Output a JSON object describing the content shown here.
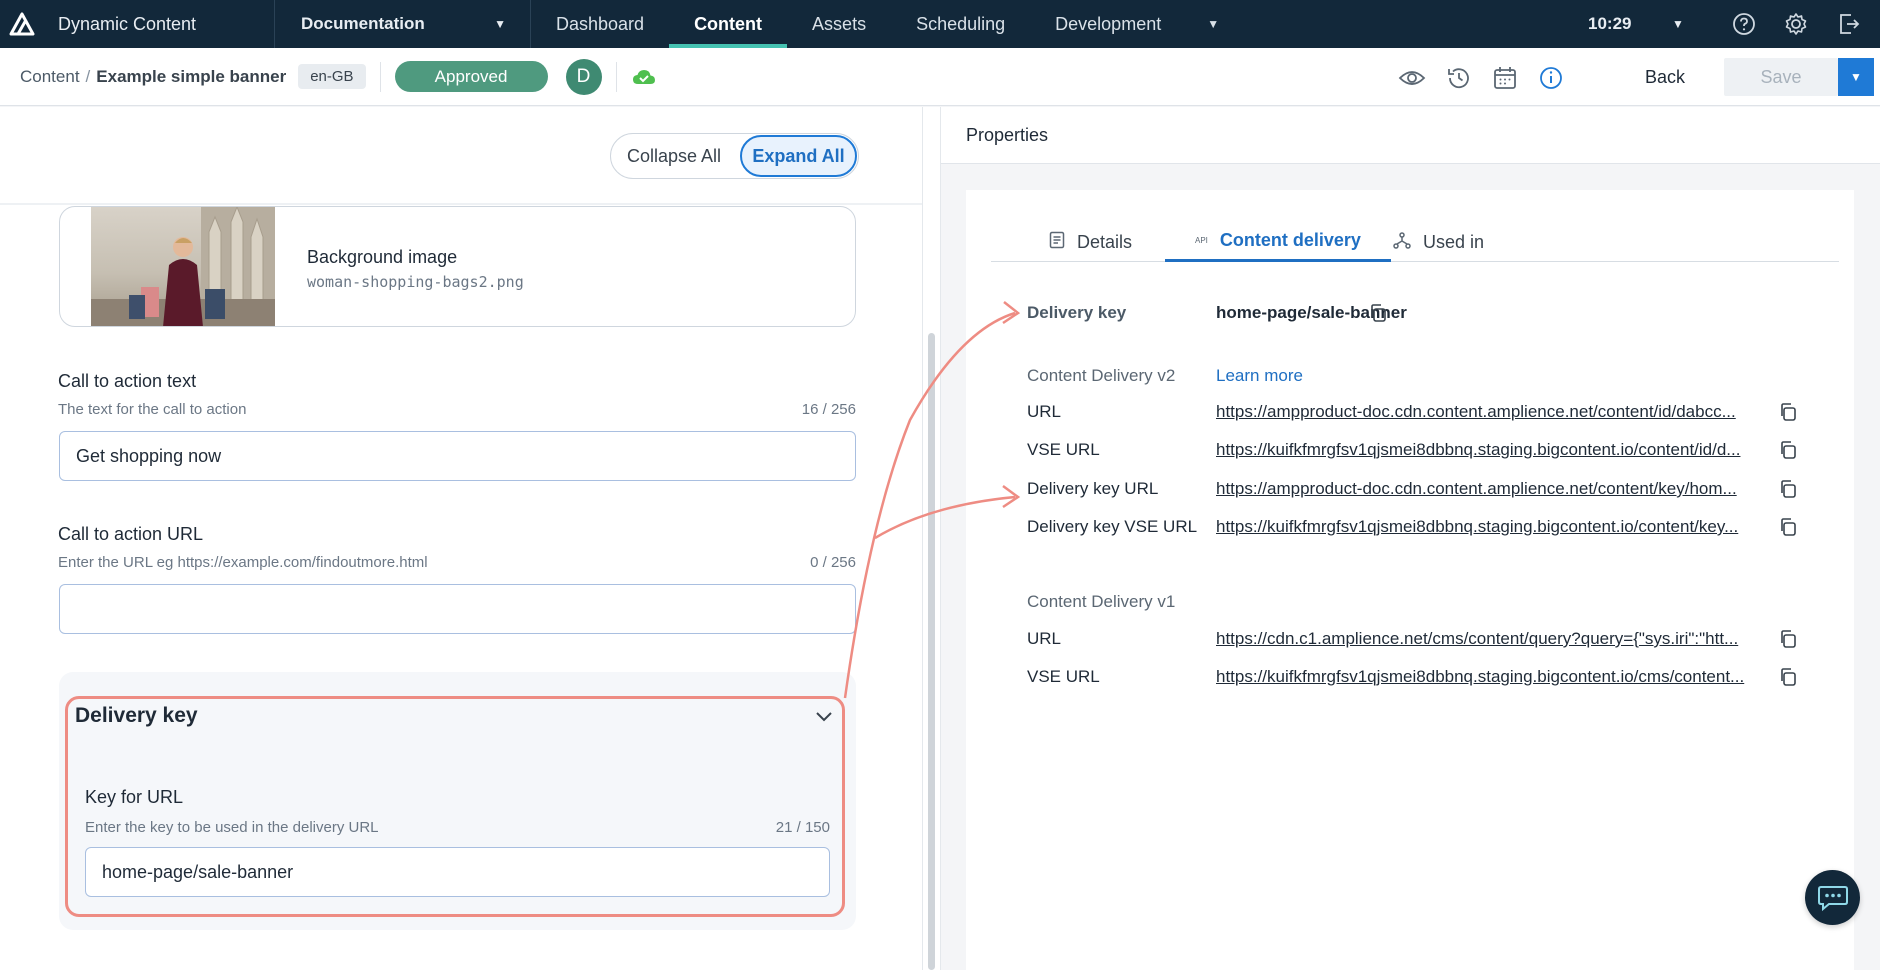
{
  "app": {
    "title": "Dynamic Content"
  },
  "nav": {
    "hub": "Documentation",
    "tabs": [
      {
        "label": "Dashboard"
      },
      {
        "label": "Content"
      },
      {
        "label": "Assets"
      },
      {
        "label": "Scheduling"
      },
      {
        "label": "Development"
      }
    ],
    "time": "10:29"
  },
  "toolbar": {
    "breadcrumb_root": "Content",
    "breadcrumb_sep": "/",
    "breadcrumb_current": "Example simple banner",
    "locale": "en-GB",
    "status": "Approved",
    "avatar_initial": "D",
    "back_label": "Back",
    "save_label": "Save"
  },
  "editor": {
    "collapse_all": "Collapse All",
    "expand_all": "Expand All",
    "image": {
      "title": "Background image",
      "filename": "woman-shopping-bags2.png"
    },
    "cta_text": {
      "label": "Call to action text",
      "help": "The text for the call to action",
      "count": "16 / 256",
      "value": "Get shopping now"
    },
    "cta_url": {
      "label": "Call to action URL",
      "help": "Enter the URL eg https://example.com/findoutmore.html",
      "count": "0 / 256",
      "value": ""
    },
    "delivery_key": {
      "title": "Delivery key",
      "label": "Key for URL",
      "help": "Enter the key to be used in the delivery URL",
      "count": "21 / 150",
      "value": "home-page/sale-banner"
    }
  },
  "properties": {
    "title": "Properties",
    "tabs": [
      {
        "label": "Details",
        "icon": "details-icon"
      },
      {
        "label": "Content delivery",
        "icon": "api-icon",
        "icon_text": "API"
      },
      {
        "label": "Used in",
        "icon": "hierarchy-icon"
      }
    ],
    "delivery_key_label": "Delivery key",
    "delivery_key_value": "home-page/sale-banner",
    "v2": {
      "heading": "Content Delivery v2",
      "learn_more": "Learn more",
      "rows": [
        {
          "label": "URL",
          "value": "https://ampproduct-doc.cdn.content.amplience.net/content/id/dabcc..."
        },
        {
          "label": "VSE URL",
          "value": "https://kuifkfmrgfsv1qjsmei8dbbnq.staging.bigcontent.io/content/id/d..."
        },
        {
          "label": "Delivery key URL",
          "value": "https://ampproduct-doc.cdn.content.amplience.net/content/key/hom..."
        },
        {
          "label": "Delivery key VSE URL",
          "value": "https://kuifkfmrgfsv1qjsmei8dbbnq.staging.bigcontent.io/content/key..."
        }
      ]
    },
    "v1": {
      "heading": "Content Delivery v1",
      "rows": [
        {
          "label": "URL",
          "value": "https://cdn.c1.amplience.net/cms/content/query?query={\"sys.iri\":\"htt..."
        },
        {
          "label": "VSE URL",
          "value": "https://kuifkfmrgfsv1qjsmei8dbbnq.staging.bigcontent.io/cms/content..."
        }
      ]
    }
  },
  "colors": {
    "nav_bg": "#12283a",
    "accent_teal": "#45c2b1",
    "status_green": "#4f9a7f",
    "primary_blue": "#1f7ad6",
    "annotation_salmon": "#ee8c83"
  }
}
